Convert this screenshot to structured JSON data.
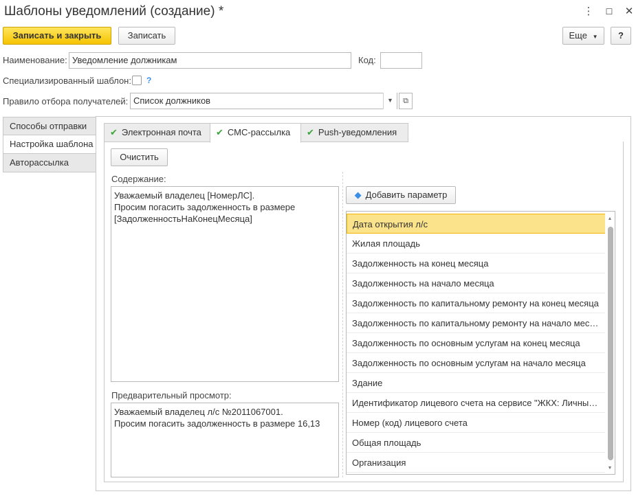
{
  "window": {
    "title": "Шаблоны уведомлений (создание) *",
    "controls": {
      "menu": "⋮",
      "maximize": "☐",
      "close": "✕"
    }
  },
  "toolbar": {
    "save_close_label": "Записать и закрыть",
    "save_label": "Записать",
    "more_label": "Еще",
    "help_label": "?"
  },
  "form": {
    "name_label": "Наименование:",
    "name_value": "Уведомление должникам",
    "code_label": "Код:",
    "code_value": "",
    "specialized_label": "Специализированный шаблон:",
    "specialized_help": "?",
    "rule_label": "Правило отбора получателей:",
    "rule_value": "Список должников"
  },
  "left_tabs": [
    {
      "label": "Способы отправки",
      "active": false
    },
    {
      "label": "Настройка шаблона",
      "active": true
    },
    {
      "label": "Авторассылка",
      "active": false
    }
  ],
  "top_tabs": [
    {
      "label": "Электронная почта",
      "active": false
    },
    {
      "label": "СМС-рассылка",
      "active": true
    },
    {
      "label": "Push-уведомления",
      "active": false
    }
  ],
  "sms": {
    "clear_label": "Очистить",
    "content_label": "Содержание:",
    "content_text": "Уважаемый владелец [НомерЛС].\nПросим погасить задолженность в размере [ЗадолженностьНаКонецМесяца]",
    "preview_label": "Предварительный просмотр:",
    "preview_text": "Уважаемый владелец л/с №2011067001.\nПросим погасить задолженность в размере 16,13",
    "add_param_label": "Добавить параметр",
    "parameters": [
      "Дата открытия л/с",
      "Жилая площадь",
      "Задолженность на конец месяца",
      "Задолженность на начало месяца",
      "Задолженность по капитальному ремонту на конец месяца",
      "Задолженность по капитальному ремонту на начало мес…",
      "Задолженность по основным услугам на конец месяца",
      "Задолженность по основным услугам на начало месяца",
      "Здание",
      "Идентификатор лицевого счета на сервисе \"ЖКХ: Личный…",
      "Номер (код) лицевого счета",
      "Общая площадь",
      "Организация"
    ]
  },
  "colors": {
    "primary_button": "#f5c400",
    "selected_row": "#fbe38b",
    "tick": "#3aa53a"
  }
}
